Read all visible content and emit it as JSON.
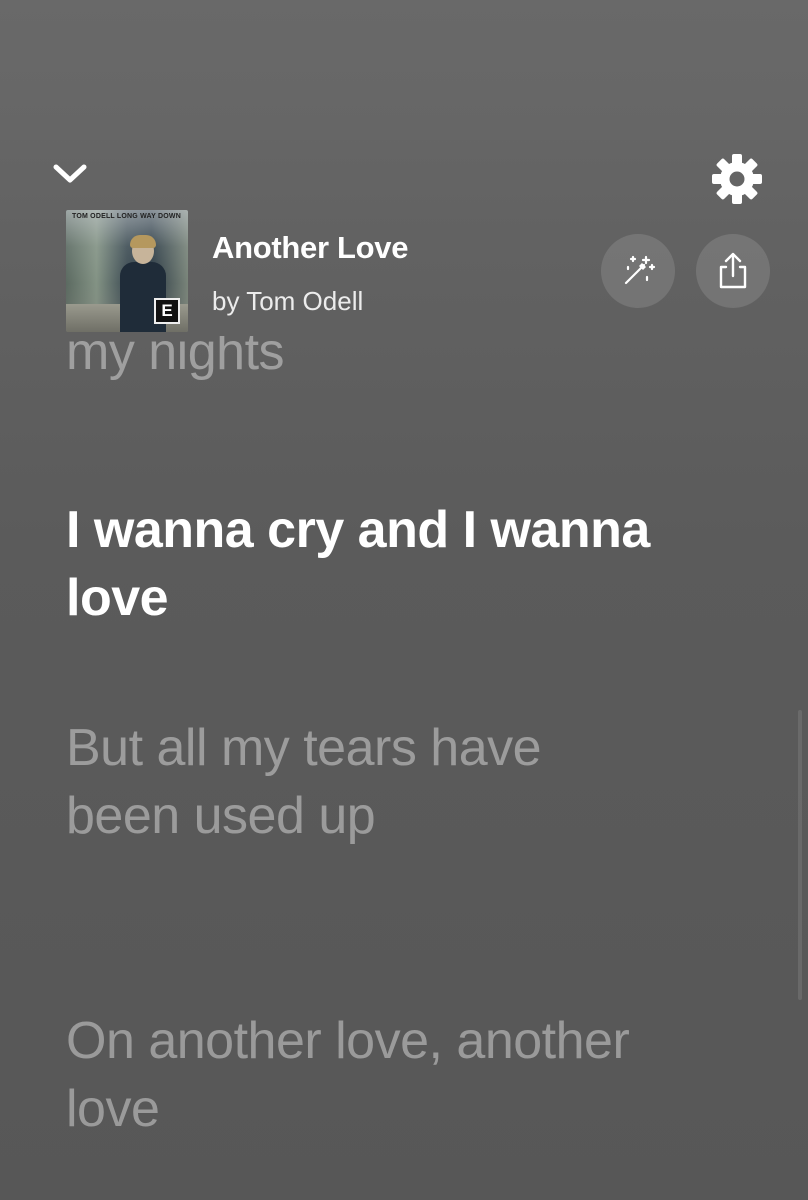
{
  "header": {
    "song_title": "Another Love",
    "artist_line": "by Tom Odell",
    "album_art_text": "TOM ODELL LONG WAY DOWN",
    "explicit_badge": "E"
  },
  "icons": {
    "collapse": "chevron-down-icon",
    "settings": "gear-icon",
    "magic": "magic-wand-icon",
    "share": "share-icon"
  },
  "lyrics": {
    "previous_partial": "my nights",
    "current": "I wanna cry and I wanna love",
    "next_1": "But all my tears have been used up",
    "next_2": "On another love, another love"
  },
  "colors": {
    "background": "#5e5e5e",
    "active_lyric": "#ffffff",
    "dim_lyric": "rgba(255,255,255,0.40)"
  }
}
